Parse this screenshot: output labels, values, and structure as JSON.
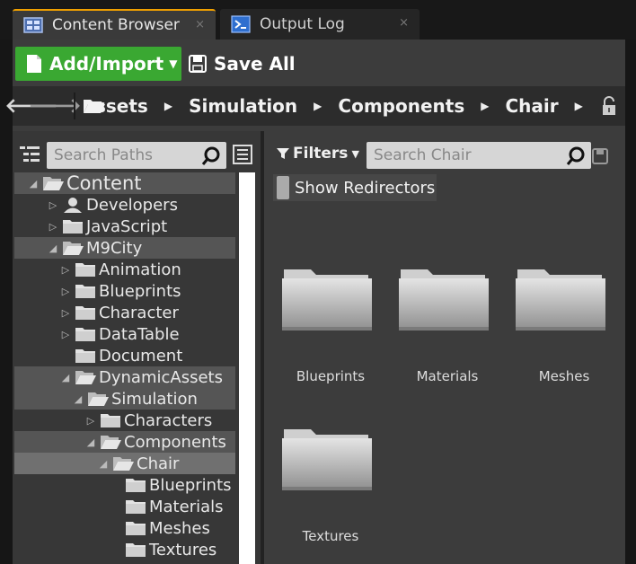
{
  "tabs": [
    {
      "label": "Content Browser",
      "close": "×",
      "icon": "content-browser-icon",
      "active": true
    },
    {
      "label": "Output Log",
      "close": "×",
      "icon": "output-log-icon",
      "active": false
    }
  ],
  "toolbar": {
    "add_label": "Add/Import",
    "save_label": "Save All"
  },
  "breadcrumb": [
    "ssets",
    "Simulation",
    "Components",
    "Chair"
  ],
  "left": {
    "search_placeholder": "Search Paths",
    "tree": [
      {
        "label": "Content",
        "level": 0,
        "expanded": true,
        "state": "highlight",
        "type": "folder-open"
      },
      {
        "label": "Developers",
        "level": 1,
        "expanded": false,
        "state": "",
        "type": "developer"
      },
      {
        "label": "JavaScript",
        "level": 1,
        "expanded": false,
        "state": "",
        "type": "folder"
      },
      {
        "label": "M9City",
        "level": 1,
        "expanded": true,
        "state": "highlight",
        "type": "folder-open"
      },
      {
        "label": "Animation",
        "level": 2,
        "expanded": false,
        "state": "",
        "type": "folder"
      },
      {
        "label": "Blueprints",
        "level": 2,
        "expanded": false,
        "state": "",
        "type": "folder"
      },
      {
        "label": "Character",
        "level": 2,
        "expanded": false,
        "state": "",
        "type": "folder"
      },
      {
        "label": "DataTable",
        "level": 2,
        "expanded": false,
        "state": "",
        "type": "folder"
      },
      {
        "label": "Document",
        "level": 2,
        "expanded": null,
        "state": "",
        "type": "folder"
      },
      {
        "label": "DynamicAssets",
        "level": 2,
        "expanded": true,
        "state": "highlight",
        "type": "folder-open"
      },
      {
        "label": "Simulation",
        "level": 3,
        "expanded": true,
        "state": "highlight",
        "type": "folder-open"
      },
      {
        "label": "Characters",
        "level": 4,
        "expanded": false,
        "state": "",
        "type": "folder"
      },
      {
        "label": "Components",
        "level": 4,
        "expanded": true,
        "state": "highlight",
        "type": "folder-open"
      },
      {
        "label": "Chair",
        "level": 5,
        "expanded": true,
        "state": "selected",
        "type": "folder-open"
      },
      {
        "label": "Blueprints",
        "level": 6,
        "expanded": null,
        "state": "",
        "type": "folder"
      },
      {
        "label": "Materials",
        "level": 6,
        "expanded": null,
        "state": "",
        "type": "folder"
      },
      {
        "label": "Meshes",
        "level": 6,
        "expanded": null,
        "state": "",
        "type": "folder"
      },
      {
        "label": "Textures",
        "level": 6,
        "expanded": null,
        "state": "",
        "type": "folder"
      }
    ]
  },
  "right": {
    "filters_label": "Filters",
    "search_placeholder": "Search Chair",
    "redirectors_label": "Show Redirectors",
    "folders": [
      "Blueprints",
      "Materials",
      "Meshes",
      "Textures"
    ]
  },
  "colors": {
    "accent_tab": "#f0a000",
    "add_button": "#3aa832",
    "background": "#3c3c3c"
  }
}
